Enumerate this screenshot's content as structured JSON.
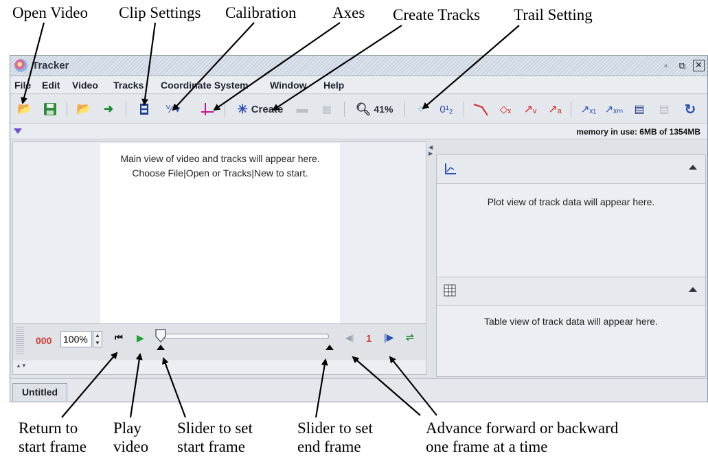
{
  "annotations": {
    "open_video": "Open Video",
    "clip_settings": "Clip Settings",
    "calibration": "Calibration",
    "axes": "Axes",
    "create_tracks": "Create Tracks",
    "trail_setting": "Trail Setting",
    "return_start": "Return to\nstart frame",
    "play_video": "Play\nvideo",
    "slider_start": "Slider to set\nstart frame",
    "slider_end": "Slider to set\nend frame",
    "advance": "Advance forward or backward\none frame at a time"
  },
  "window": {
    "title": "Tracker",
    "controls": [
      "minimize-icon",
      "restore-icon",
      "close-icon"
    ]
  },
  "menubar": {
    "items": [
      "File",
      "Edit",
      "Video",
      "Tracks",
      "Coordinate System",
      "Window",
      "Help"
    ]
  },
  "toolbar": {
    "create_label": "Create",
    "zoom_label": "41%",
    "icons": [
      "open-folder-icon",
      "save-icon",
      "open-browser-icon",
      "import-icon",
      "clip-settings-icon",
      "calibration-icon",
      "axes-icon",
      "create-tracks-icon",
      "ruler-icon",
      "image-icon",
      "zoom-icon",
      "trail-icon",
      "label-icon",
      "path-icon",
      "position-icon",
      "velocity-icon",
      "acceleration-icon",
      "x1-icon",
      "xm-icon",
      "notes-icon",
      "copy-icon",
      "refresh-icon"
    ]
  },
  "infobar": {
    "memory": "memory in use: 6MB of 1354MB"
  },
  "main_view": {
    "message": "Main view of video and tracks will appear here.\nChoose File|Open or Tracks|New to start."
  },
  "player": {
    "frame_count": "000",
    "zoom_value": "100%",
    "step_size": "1"
  },
  "plot_view": {
    "message": "Plot view of track data will appear here."
  },
  "table_view": {
    "message": "Table view of track data will appear here."
  },
  "tabs": [
    "Untitled"
  ],
  "colors": {
    "accent_red": "#d43a32",
    "play_green": "#19a32d",
    "step_blue": "#2a4fb3"
  }
}
